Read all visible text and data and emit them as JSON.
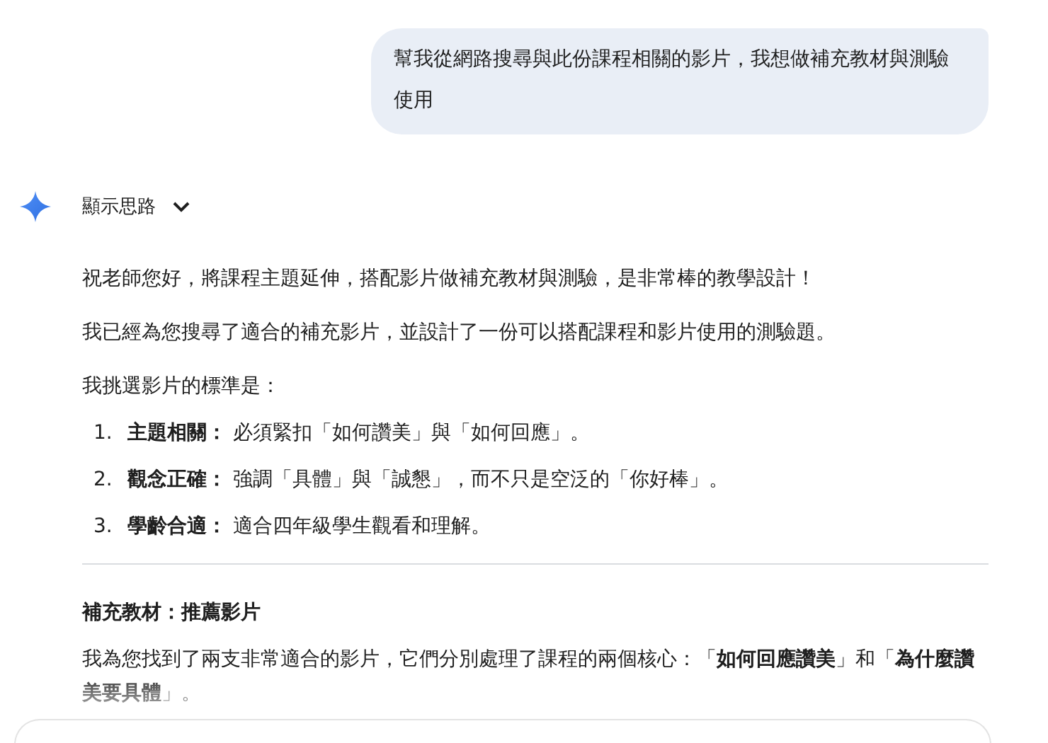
{
  "user_message": {
    "text": "幫我從網路搜尋與此份課程相關的影片，我想做補充教材與測驗使用"
  },
  "response": {
    "thoughts_toggle": {
      "label": "顯示思路",
      "expanded": false
    },
    "paragraphs": [
      "祝老師您好，將課程主題延伸，搭配影片做補充教材與測驗，是非常棒的教學設計！",
      "我已經為您搜尋了適合的補充影片，並設計了一份可以搭配課程和影片使用的測驗題。",
      "我挑選影片的標準是："
    ],
    "criteria": [
      {
        "number": "1.",
        "text": "**主題相關：** 必須緊扣「如何讚美」與「如何回應」。"
      },
      {
        "number": "2.",
        "text": "**觀念正確：** 強調「具體」與「誠懇」，而不只是空泛的「你好棒」。"
      },
      {
        "number": "3.",
        "text": "**學齡合適：** 適合四年級學生觀看和理解。"
      }
    ],
    "section_heading": "補充教材：推薦影片",
    "section_paragraph": "我為您找到了兩支非常適合的影片，它們分別處理了課程的兩個核心：「**如何回應讚美**」和「**為什麼讚美要具體**」。"
  }
}
